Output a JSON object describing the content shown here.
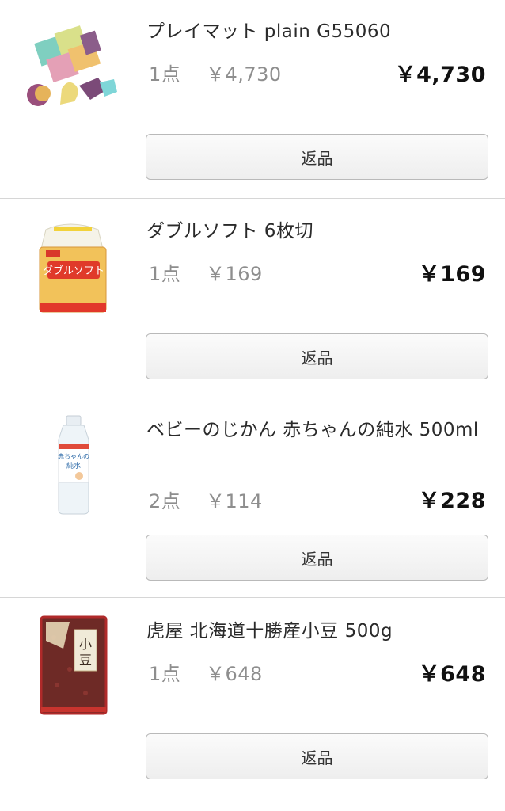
{
  "order_items": [
    {
      "product_name": "プレイマット plain G55060",
      "quantity": "1点",
      "unit_price": "￥4,730",
      "line_total": "￥4,730",
      "return_label": "返品"
    },
    {
      "product_name": "ダブルソフト 6枚切",
      "quantity": "1点",
      "unit_price": "￥169",
      "line_total": "￥169",
      "return_label": "返品"
    },
    {
      "product_name": "ベビーのじかん 赤ちゃんの純水 500ml",
      "quantity": "2点",
      "unit_price": "￥114",
      "line_total": "￥228",
      "return_label": "返品"
    },
    {
      "product_name": "虎屋 北海道十勝産小豆 500g",
      "quantity": "1点",
      "unit_price": "￥648",
      "line_total": "￥648",
      "return_label": "返品"
    }
  ],
  "colors": {
    "divider": "#d6d6d6",
    "muted_text": "#8e8e8e",
    "total_text": "#111111",
    "button_border": "#b9b9b9"
  },
  "icons": [
    "playmat-image",
    "bread-image",
    "water-bottle-image",
    "azuki-bag-image"
  ]
}
